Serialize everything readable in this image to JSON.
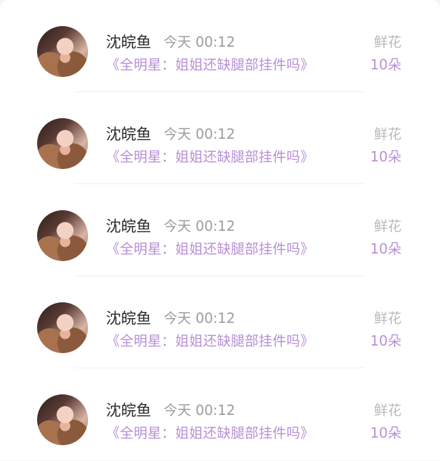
{
  "list": {
    "items": [
      {
        "name": "沈皖鱼",
        "time": "今天 00:12",
        "title": "《全明星：姐姐还缺腿部挂件吗》",
        "gift": "鲜花",
        "count": "10朵",
        "avatar_icon": "user-avatar"
      },
      {
        "name": "沈皖鱼",
        "time": "今天 00:12",
        "title": "《全明星：姐姐还缺腿部挂件吗》",
        "gift": "鲜花",
        "count": "10朵",
        "avatar_icon": "user-avatar"
      },
      {
        "name": "沈皖鱼",
        "time": "今天 00:12",
        "title": "《全明星：姐姐还缺腿部挂件吗》",
        "gift": "鲜花",
        "count": "10朵",
        "avatar_icon": "user-avatar"
      },
      {
        "name": "沈皖鱼",
        "time": "今天 00:12",
        "title": "《全明星：姐姐还缺腿部挂件吗》",
        "gift": "鲜花",
        "count": "10朵",
        "avatar_icon": "user-avatar"
      },
      {
        "name": "沈皖鱼",
        "time": "今天 00:12",
        "title": "《全明星：姐姐还缺腿部挂件吗》",
        "gift": "鲜花",
        "count": "10朵",
        "avatar_icon": "user-avatar"
      }
    ]
  },
  "colors": {
    "accent_purple": "#b88fd7",
    "name_text": "#2c2c2c",
    "meta_gray": "#9b9ba1",
    "background": "#ffffff"
  }
}
